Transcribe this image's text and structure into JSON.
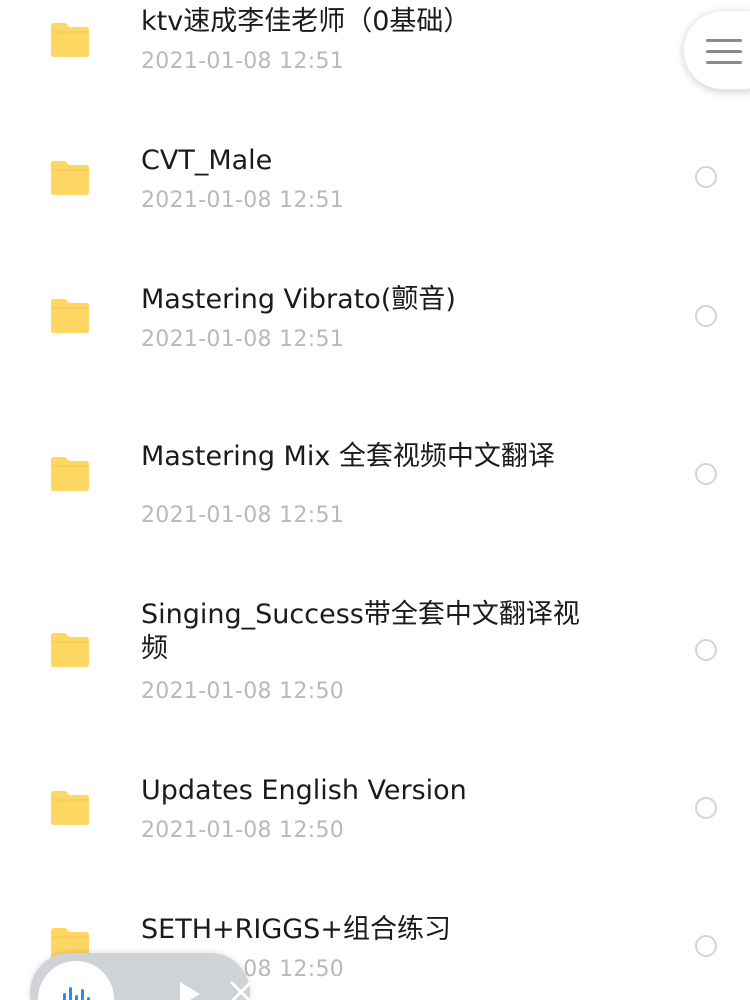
{
  "files": [
    {
      "name": "ktv速成李佳老师（0基础）",
      "date": "2021-01-08 12:51"
    },
    {
      "name": "CVT_Male",
      "date": "2021-01-08 12:51"
    },
    {
      "name": "Mastering Vibrato(颤音)",
      "date": "2021-01-08 12:51"
    },
    {
      "name": "Mastering Mix 全套视频中文翻译",
      "date": "2021-01-08 12:51"
    },
    {
      "name": "Singing_Success带全套中文翻译视频",
      "date": "2021-01-08 12:50"
    },
    {
      "name": "Updates English Version",
      "date": "2021-01-08 12:50"
    },
    {
      "name": "SETH+RIGGS+组合练习",
      "date": "2021-01-08 12:50"
    }
  ],
  "icons": {
    "folder": "folder-icon",
    "menu": "menu-icon",
    "waveform": "waveform-icon",
    "play": "play-icon",
    "close": "close-icon"
  },
  "colors": {
    "folder": "#fdd663",
    "date": "#b9b9b9",
    "accent": "#2d8cf0"
  }
}
